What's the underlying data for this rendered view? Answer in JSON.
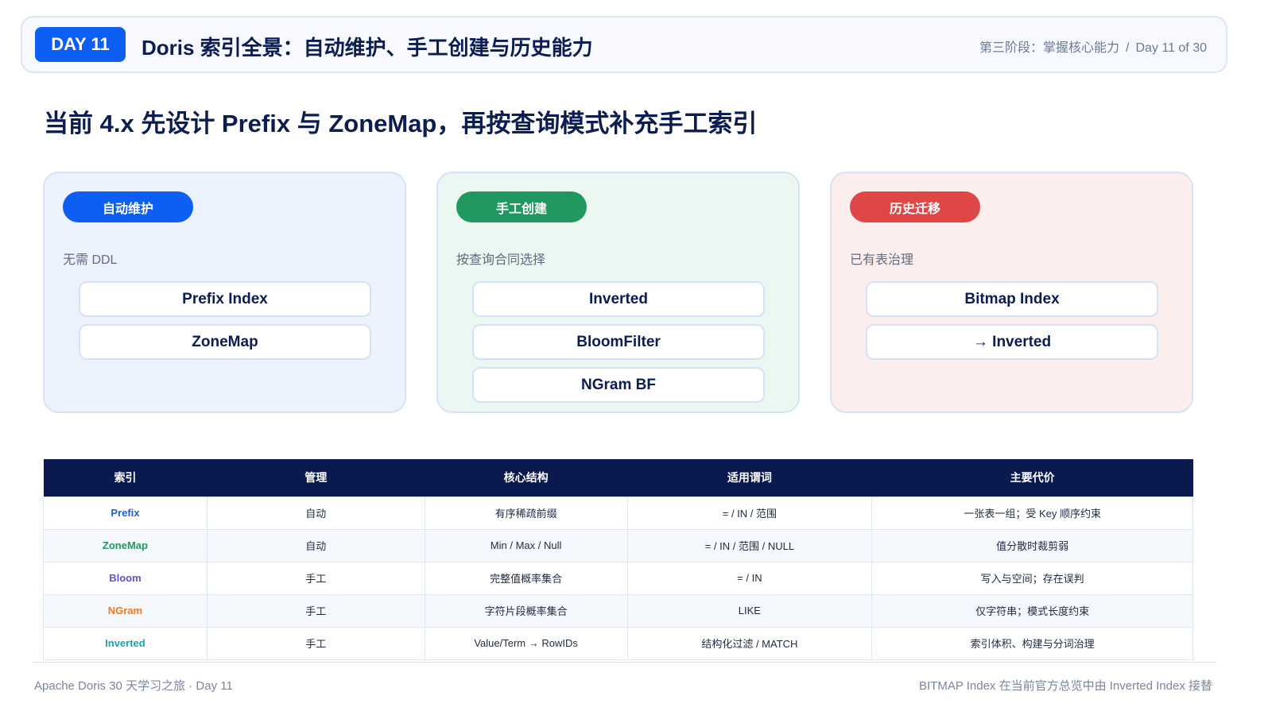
{
  "header": {
    "day": "DAY 11",
    "title": "Doris 索引全景：自动维护、手工创建与历史能力",
    "stage": "第三阶段：掌握核心能力",
    "separator": "/",
    "progress": "Day 11 of 30"
  },
  "main_title": "当前 4.x 先设计 Prefix 与 ZoneMap，再按查询模式补充手工索引",
  "cards": [
    {
      "label": "自动维护",
      "subtitle": "无需 DDL",
      "items": [
        "Prefix Index",
        "ZoneMap"
      ],
      "color": "#0d5ef2"
    },
    {
      "label": "手工创建",
      "subtitle": "按查询合同选择",
      "items": [
        "Inverted",
        "BloomFilter",
        "NGram BF"
      ],
      "color": "#219860"
    },
    {
      "label": "历史迁移",
      "subtitle": "已有表治理",
      "items": [
        "Bitmap Index",
        "→ Inverted"
      ],
      "color": "#df4646"
    }
  ],
  "table": {
    "headers": [
      "索引",
      "管理",
      "核心结构",
      "适用谓词",
      "主要代价"
    ],
    "rows": [
      {
        "name": "Prefix",
        "color": "#1b5fd6",
        "cells": [
          "自动",
          "有序稀疏前缀",
          "= / IN / 范围",
          "一张表一组；受 Key 顺序约束"
        ]
      },
      {
        "name": "ZoneMap",
        "color": "#1f9a5c",
        "cells": [
          "自动",
          "Min / Max / Null",
          "= / IN / 范围 / NULL",
          "值分散时裁剪弱"
        ]
      },
      {
        "name": "Bloom",
        "color": "#6b4fd1",
        "cells": [
          "手工",
          "完整值概率集合",
          "= / IN",
          "写入与空间；存在误判"
        ]
      },
      {
        "name": "NGram",
        "color": "#f07a1a",
        "cells": [
          "手工",
          "字符片段概率集合",
          "LIKE",
          "仅字符串；模式长度约束"
        ]
      },
      {
        "name": "Inverted",
        "color": "#17a6a8",
        "cells": [
          "手工",
          "Value/Term → RowIDs",
          "结构化过滤 / MATCH",
          "索引体积、构建与分词治理"
        ]
      }
    ]
  },
  "footer": {
    "left": "Apache Doris 30 天学习之旅 · Day 11",
    "right": "BITMAP Index 在当前官方总览中由 Inverted Index 接替"
  }
}
